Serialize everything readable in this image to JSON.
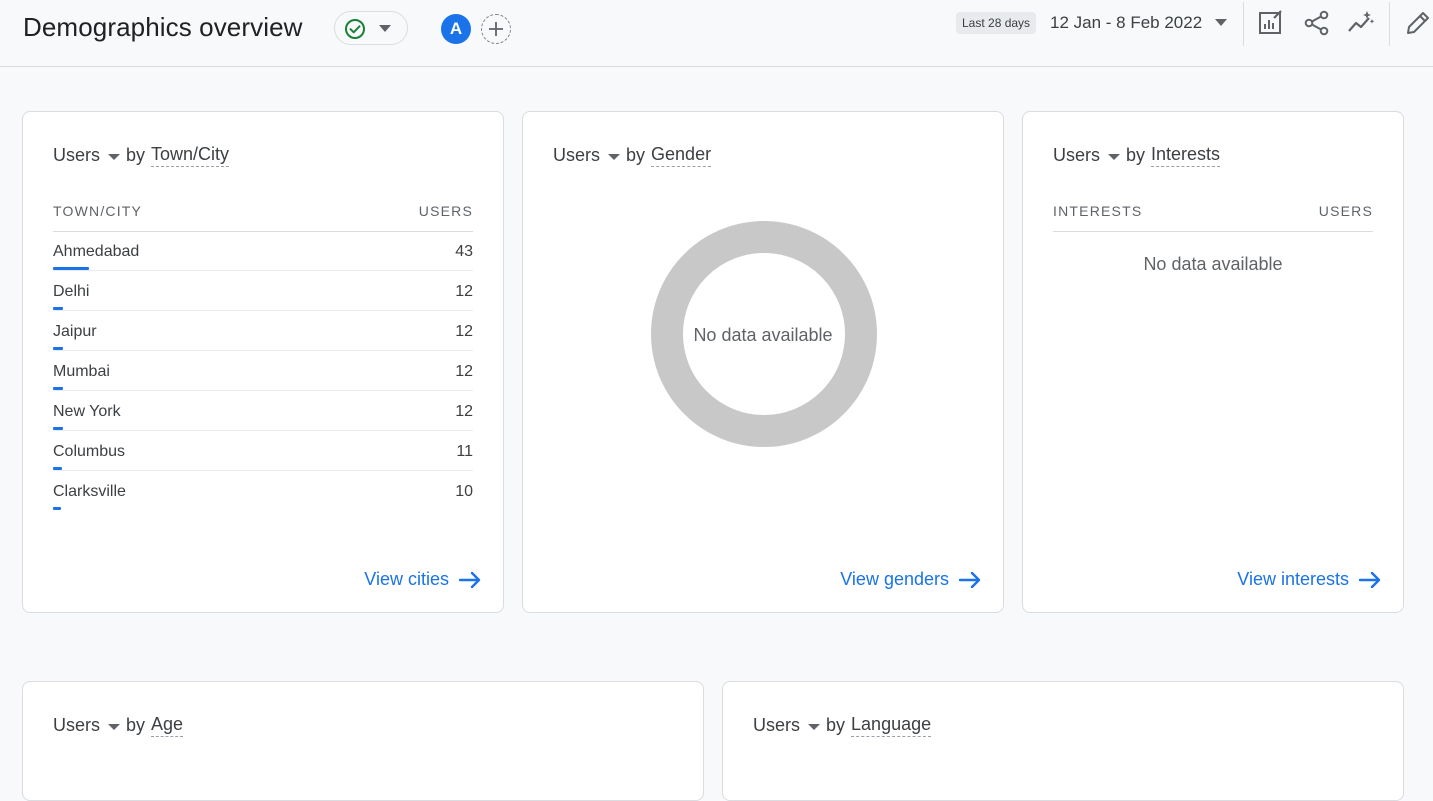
{
  "header": {
    "title": "Demographics overview",
    "avatar_letter": "A",
    "date_chip": "Last 28 days",
    "date_range": "12 Jan - 8 Feb 2022"
  },
  "cards": {
    "city": {
      "metric": "Users",
      "by": "by",
      "dimension": "Town/City",
      "col1": "TOWN/CITY",
      "col2": "USERS",
      "rows": [
        {
          "name": "Ahmedabad",
          "value": "43",
          "share": 1.0
        },
        {
          "name": "Delhi",
          "value": "12",
          "share": 0.28
        },
        {
          "name": "Jaipur",
          "value": "12",
          "share": 0.28
        },
        {
          "name": "Mumbai",
          "value": "12",
          "share": 0.28
        },
        {
          "name": "New York",
          "value": "12",
          "share": 0.28
        },
        {
          "name": "Columbus",
          "value": "11",
          "share": 0.26
        },
        {
          "name": "Clarksville",
          "value": "10",
          "share": 0.23
        }
      ],
      "link": "View cities"
    },
    "gender": {
      "metric": "Users",
      "by": "by",
      "dimension": "Gender",
      "no_data": "No data available",
      "link": "View genders"
    },
    "interests": {
      "metric": "Users",
      "by": "by",
      "dimension": "Interests",
      "col1": "INTERESTS",
      "col2": "USERS",
      "no_data": "No data available",
      "link": "View interests"
    },
    "age": {
      "metric": "Users",
      "by": "by",
      "dimension": "Age"
    },
    "language": {
      "metric": "Users",
      "by": "by",
      "dimension": "Language"
    }
  },
  "colors": {
    "accent": "#1a73e8",
    "status_ok": "#188038",
    "donut_empty": "#c8c8c8"
  },
  "icons": {
    "status": "check-circle-icon",
    "customize": "customize-report-icon",
    "share": "share-icon",
    "insights": "insights-icon",
    "edit": "pencil-icon"
  }
}
